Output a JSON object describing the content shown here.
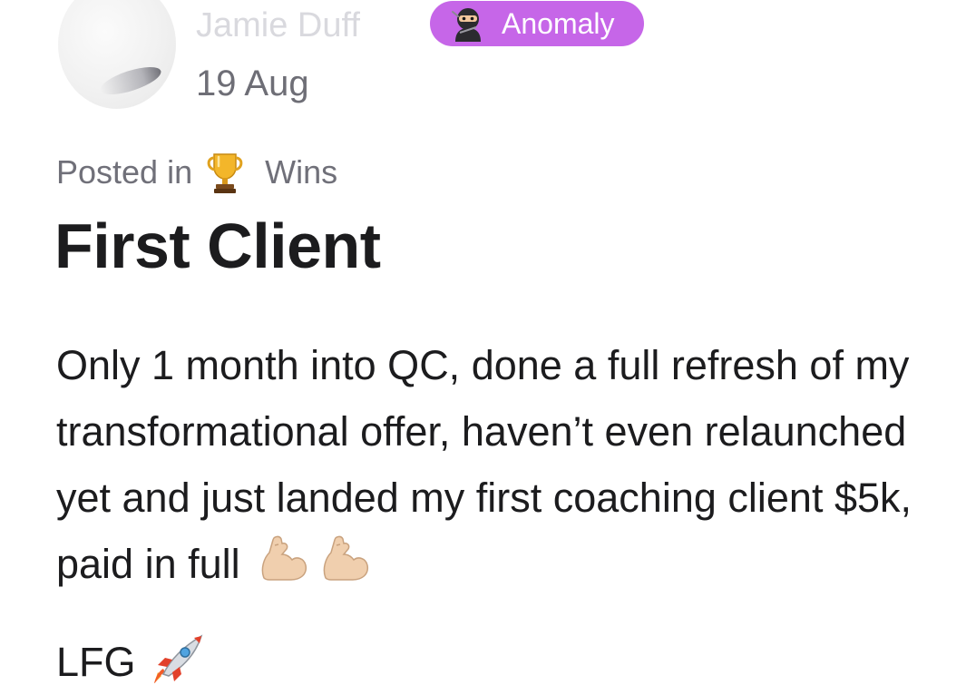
{
  "author": {
    "name": "Jamie Duff",
    "date": "19 Aug"
  },
  "badge": {
    "label": "Anomaly",
    "icon": "ninja-icon",
    "color": "#c666e8"
  },
  "category": {
    "prefix": "Posted in",
    "icon": "trophy-icon",
    "name": "Wins"
  },
  "post": {
    "title": "First Client",
    "body": "Only 1 month into QC, done a full refresh of my transformational offer, haven’t even relaunched yet and just landed my first coaching client $5k, paid in full",
    "body_emoji": [
      "flexed-biceps-icon",
      "flexed-biceps-icon"
    ],
    "closing": "LFG",
    "closing_emoji": "rocket-icon"
  }
}
